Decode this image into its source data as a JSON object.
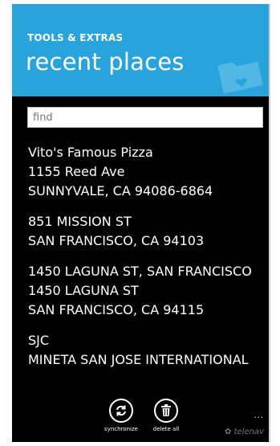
{
  "header": {
    "section_label": "TOOLS & EXTRAS",
    "title": "recent places",
    "accent_color": "#29a3dc"
  },
  "search": {
    "placeholder": "find",
    "value": ""
  },
  "places": [
    {
      "lines": [
        "Vito's Famous Pizza",
        "1155 Reed Ave",
        "SUNNYVALE, CA 94086-6864"
      ]
    },
    {
      "lines": [
        "851 MISSION ST",
        "SAN FRANCISCO, CA 94103"
      ]
    },
    {
      "lines": [
        "1450 LAGUNA ST, SAN FRANCISCO",
        "1450 LAGUNA ST",
        "SAN FRANCISCO, CA 94115"
      ]
    },
    {
      "lines": [
        "SJC",
        "MINETA SAN JOSE INTERNATIONAL"
      ]
    }
  ],
  "appbar": {
    "buttons": [
      {
        "label": "synchronize",
        "icon": "sync-icon"
      },
      {
        "label": "delete all",
        "icon": "trash-icon"
      }
    ],
    "more": "...",
    "brand": "telenav"
  }
}
